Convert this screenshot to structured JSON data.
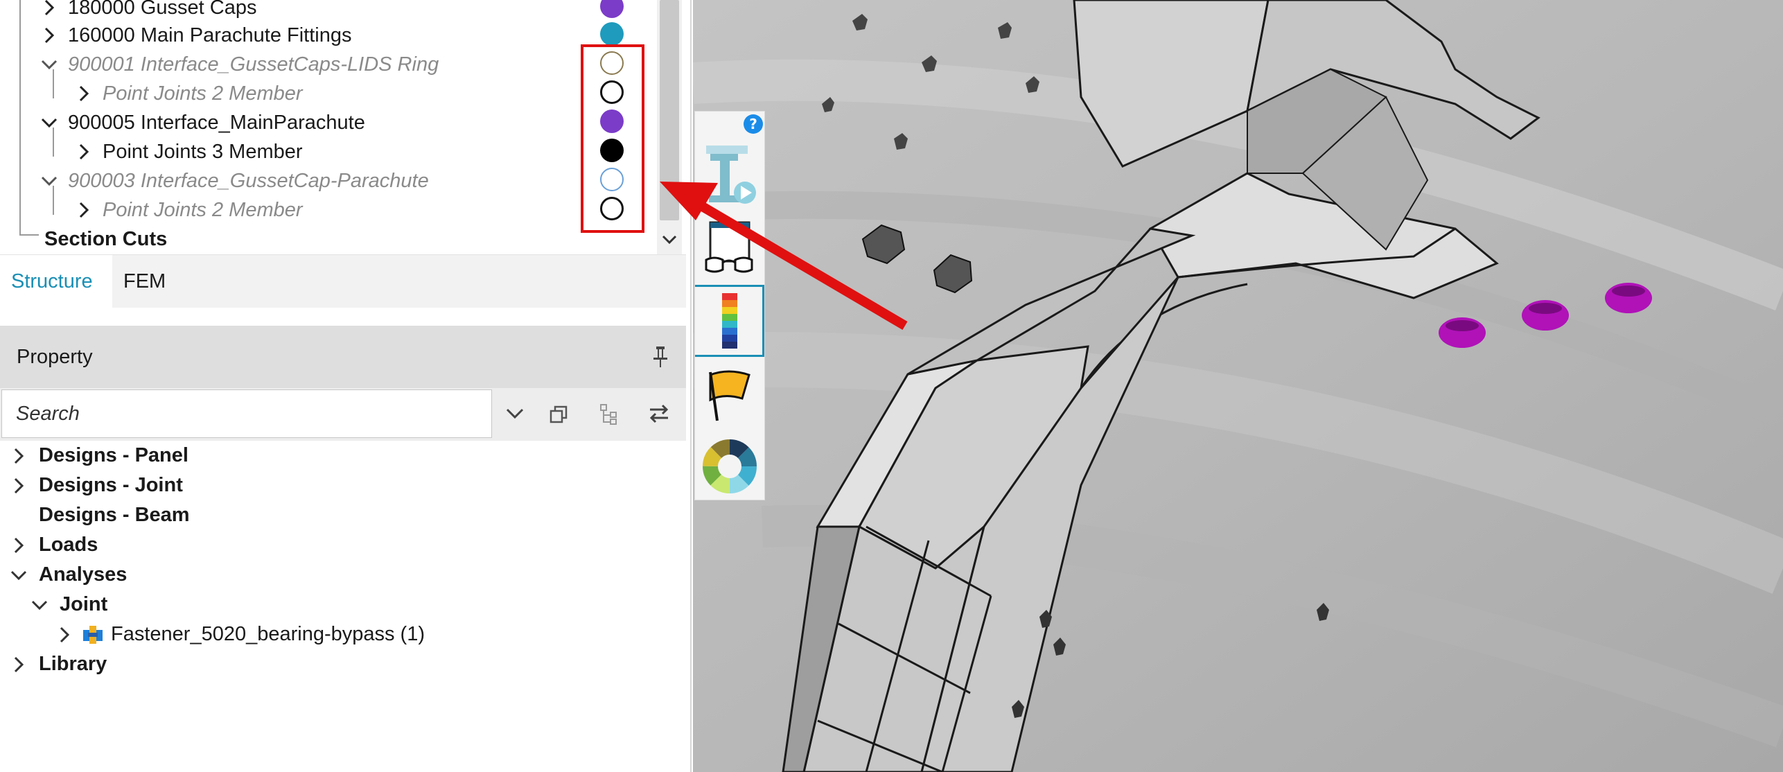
{
  "tree": {
    "items": [
      {
        "label": "180000 Gusset Caps",
        "color": "#7b3cc8",
        "style": "filled"
      },
      {
        "label": "160000 Main Parachute Fittings",
        "color": "#1e9bbd",
        "style": "filled"
      },
      {
        "label": "900001 Interface_GussetCaps-LIDS Ring",
        "color": "#8a7a50",
        "style": "ring"
      },
      {
        "label": "Point Joints 2 Member",
        "color": "#111111",
        "style": "ring"
      },
      {
        "label": "900005 Interface_MainParachute",
        "color": "#7b3cc8",
        "style": "filled"
      },
      {
        "label": "Point Joints 3 Member",
        "color": "#000000",
        "style": "filled"
      },
      {
        "label": "900003 Interface_GussetCap-Parachute",
        "color": "#6aa0d8",
        "style": "ring"
      },
      {
        "label": "Point Joints 2 Member",
        "color": "#111111",
        "style": "ring"
      },
      {
        "label": "Section Cuts"
      }
    ]
  },
  "tabs": [
    {
      "label": "Structure",
      "active": true
    },
    {
      "label": "FEM",
      "active": false
    }
  ],
  "property": {
    "title": "Property",
    "search_placeholder": "Search",
    "items": [
      {
        "label": "Designs - Panel"
      },
      {
        "label": "Designs - Joint"
      },
      {
        "label": "Designs - Beam"
      },
      {
        "label": "Loads"
      },
      {
        "label": "Analyses"
      },
      {
        "label": "Joint"
      },
      {
        "label": "Fastener_5020_bearing-bypass (1)"
      },
      {
        "label": "Library"
      }
    ]
  },
  "toolbar": {
    "help_label": "?",
    "buttons": [
      "analysis-run-icon",
      "view-glasses-icon",
      "contour-legend-icon",
      "flag-icon",
      "color-wheel-icon"
    ]
  },
  "colors": {
    "accent": "#1a8fb5",
    "highlight": "#e01010",
    "fastener_magenta": "#b012b8"
  }
}
